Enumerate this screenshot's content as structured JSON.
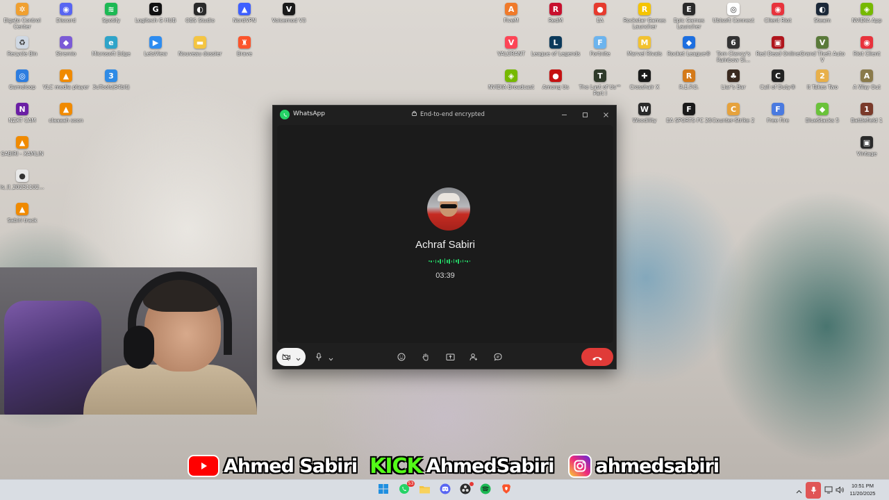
{
  "desktop_icons_left": [
    {
      "label": "Elgato Control Center",
      "icon": "elgato-icon",
      "color": "#f0a030",
      "glyph": "✲"
    },
    {
      "label": "Discord",
      "icon": "discord-icon",
      "color": "#5865f2",
      "glyph": "◉"
    },
    {
      "label": "Spotify",
      "icon": "spotify-icon",
      "color": "#1db954",
      "glyph": "≋"
    },
    {
      "label": "Logitech G HUB",
      "icon": "logitech-icon",
      "color": "#111111",
      "glyph": "G"
    },
    {
      "label": "OBS Studio",
      "icon": "obs-icon",
      "color": "#2a2a2a",
      "glyph": "◐"
    },
    {
      "label": "NordVPN",
      "icon": "nordvpn-icon",
      "color": "#3e5fff",
      "glyph": "▲"
    },
    {
      "label": "Voicemod V3",
      "icon": "voicemod-icon",
      "color": "#1a1a1a",
      "glyph": "V"
    },
    {
      "label": "Recycle Bin",
      "icon": "recycle-bin-icon",
      "color": "#cfd8e3",
      "glyph": "♻"
    },
    {
      "label": "Stremio",
      "icon": "stremio-icon",
      "color": "#7b5bd6",
      "glyph": "◆"
    },
    {
      "label": "Microsoft Edge",
      "icon": "edge-icon",
      "color": "#2fa4c9",
      "glyph": "e"
    },
    {
      "label": "LetsView",
      "icon": "letsview-icon",
      "color": "#2d8cf0",
      "glyph": "▶"
    },
    {
      "label": "Nouveau dossier",
      "icon": "folder-icon",
      "color": "#f4c542",
      "glyph": "▬"
    },
    {
      "label": "Brave",
      "icon": "brave-icon",
      "color": "#fb542b",
      "glyph": "♜"
    },
    {
      "label": "Gameloop",
      "icon": "gameloop-icon",
      "color": "#2d7de0",
      "glyph": "◎"
    },
    {
      "label": "VLC media player",
      "icon": "vlc-icon",
      "color": "#f08a00",
      "glyph": "▲"
    },
    {
      "label": "3uTools(64bit)",
      "icon": "3utools-icon",
      "color": "#2e8be6",
      "glyph": "3"
    },
    {
      "label": "NZXT CAM",
      "icon": "nzxt-icon",
      "color": "#6b1fa5",
      "glyph": "N"
    },
    {
      "label": "claaaah soon",
      "icon": "vlc-icon",
      "color": "#f08a00",
      "glyph": "▲"
    },
    {
      "label": "SABIRI - XAMLIN",
      "icon": "vlc-icon",
      "color": "#f08a00",
      "glyph": "▲"
    },
    {
      "label": "is_il_20251102...",
      "icon": "file-icon",
      "color": "#e8e8e8",
      "glyph": "●"
    },
    {
      "label": "Sabiri track",
      "icon": "vlc-icon",
      "color": "#f08a00",
      "glyph": "▲"
    }
  ],
  "desktop_icons_right": [
    {
      "label": "FiveM",
      "icon": "fivem-icon",
      "color": "#f07a2a",
      "glyph": "A"
    },
    {
      "label": "RedM",
      "icon": "redm-icon",
      "color": "#c8102e",
      "glyph": "R"
    },
    {
      "label": "EA",
      "icon": "ea-icon",
      "color": "#e63b2e",
      "glyph": "●"
    },
    {
      "label": "Rockstar Games Launcher",
      "icon": "rockstar-icon",
      "color": "#f5c400",
      "glyph": "R"
    },
    {
      "label": "Epic Games Launcher",
      "icon": "epic-icon",
      "color": "#2a2a2a",
      "glyph": "E"
    },
    {
      "label": "Ubisoft Connect",
      "icon": "ubisoft-icon",
      "color": "#ffffff",
      "glyph": "◎"
    },
    {
      "label": "Client Riot",
      "icon": "riot-icon",
      "color": "#e8333c",
      "glyph": "◉"
    },
    {
      "label": "Steam",
      "icon": "steam-icon",
      "color": "#1b2838",
      "glyph": "◐"
    },
    {
      "label": "NVIDIA App",
      "icon": "nvidia-icon",
      "color": "#76b900",
      "glyph": "◈"
    },
    {
      "label": "VALORANT",
      "icon": "valorant-icon",
      "color": "#fd4556",
      "glyph": "V"
    },
    {
      "label": "League of Legends",
      "icon": "lol-icon",
      "color": "#0b3a5b",
      "glyph": "L"
    },
    {
      "label": "Fortnite",
      "icon": "fortnite-icon",
      "color": "#6cb4ee",
      "glyph": "F"
    },
    {
      "label": "Marvel Rivals",
      "icon": "marvel-rivals-icon",
      "color": "#f2c230",
      "glyph": "M"
    },
    {
      "label": "Rocket League®",
      "icon": "rocket-league-icon",
      "color": "#1d6fe0",
      "glyph": "◆"
    },
    {
      "label": "Tom Clancy's Rainbow Si...",
      "icon": "rainbow-six-icon",
      "color": "#333333",
      "glyph": "6"
    },
    {
      "label": "Red Dead Online",
      "icon": "rdo-icon",
      "color": "#b0151c",
      "glyph": "▣"
    },
    {
      "label": "Grand Theft Auto V",
      "icon": "gta-icon",
      "color": "#5a7a3a",
      "glyph": "V"
    },
    {
      "label": "Riot Client",
      "icon": "riot-icon",
      "color": "#e8333c",
      "glyph": "◉"
    },
    {
      "label": "NVIDIA Broadcast",
      "icon": "nvidia-broadcast-icon",
      "color": "#76b900",
      "glyph": "◈"
    },
    {
      "label": "Among Us",
      "icon": "among-us-icon",
      "color": "#c51111",
      "glyph": "●"
    },
    {
      "label": "The Last of Us™ Part I",
      "icon": "tlou-icon",
      "color": "#2f3a2a",
      "glyph": "T"
    },
    {
      "label": "Crosshair X",
      "icon": "crosshair-icon",
      "color": "#1a1a1a",
      "glyph": "✚"
    },
    {
      "label": "R.E.P.O.",
      "icon": "repo-icon",
      "color": "#d47a1a",
      "glyph": "R"
    },
    {
      "label": "Liar's Bar",
      "icon": "liars-bar-icon",
      "color": "#3a2a20",
      "glyph": "♣"
    },
    {
      "label": "Call of Duty®",
      "icon": "cod-icon",
      "color": "#222222",
      "glyph": "C"
    },
    {
      "label": "It Takes Two",
      "icon": "it-takes-two-icon",
      "color": "#e8b04a",
      "glyph": "2"
    },
    {
      "label": "A Way Out",
      "icon": "a-way-out-icon",
      "color": "#8a7a4a",
      "glyph": "A"
    },
    {
      "label": "Woodility",
      "icon": "woodility-icon",
      "color": "#2a2a2a",
      "glyph": "W"
    },
    {
      "label": "EA SPORTS FC 26",
      "icon": "fc26-icon",
      "color": "#1a1a1a",
      "glyph": "F"
    },
    {
      "label": "Counter-Strike 2",
      "icon": "cs2-icon",
      "color": "#e6a23c",
      "glyph": "C"
    },
    {
      "label": "Free Fire",
      "icon": "free-fire-icon",
      "color": "#4a7ae0",
      "glyph": "F"
    },
    {
      "label": "BlueStacks 5",
      "icon": "bluestacks-icon",
      "color": "#6ac23a",
      "glyph": "◆"
    },
    {
      "label": "Battlefield 1",
      "icon": "battlefield-icon",
      "color": "#7a3a2a",
      "glyph": "1"
    },
    {
      "label": "Vintage",
      "icon": "vintage-icon",
      "color": "#2a2a2a",
      "glyph": "▣"
    }
  ],
  "whatsapp": {
    "app_title": "WhatsApp",
    "encryption_label": "End-to-end encrypted",
    "caller_name": "Achraf Sabiri",
    "call_duration": "03:39",
    "accent_color": "#25d366",
    "end_call_color": "#e03b38"
  },
  "banner": {
    "youtube_name": "Ahmed Sabiri",
    "kick_logo": "KICK",
    "kick_name": "AhmedSabiri",
    "instagram_name": "ahmedsabiri"
  },
  "taskbar": {
    "whatsapp_badge": "53",
    "clock_time": "10:51 PM",
    "clock_date": "11/20/2025"
  }
}
